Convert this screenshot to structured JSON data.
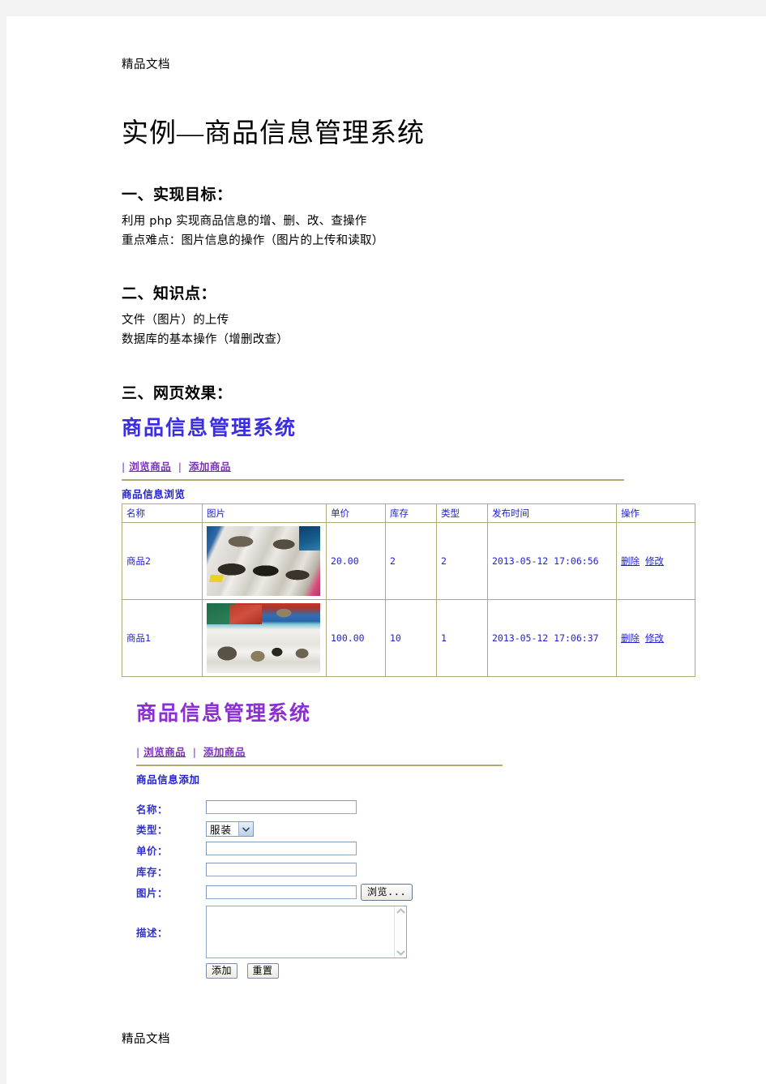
{
  "document": {
    "watermark_top": "精品文档",
    "watermark_bottom": "精品文档",
    "title": "实例—商品信息管理系统",
    "sections": [
      {
        "heading": "一、实现目标：",
        "lines": [
          "利用 php 实现商品信息的增、删、改、查操作",
          "重点难点：图片信息的操作（图片的上传和读取）"
        ]
      },
      {
        "heading": "二、知识点：",
        "lines": [
          "文件（图片）的上传",
          "数据库的基本操作（增删改查）"
        ]
      },
      {
        "heading": "三、网页效果：",
        "lines": []
      }
    ]
  },
  "mock_browse": {
    "app_title": "商品信息管理系统",
    "nav": {
      "leading_sep": "|",
      "items": [
        "浏览商品",
        "添加商品"
      ],
      "separator": "|"
    },
    "section_label": "商品信息浏览",
    "table": {
      "headers": [
        "名称",
        "图片",
        "单价",
        "库存",
        "类型",
        "发布时间",
        "操作"
      ],
      "rows": [
        {
          "name": "商品2",
          "image_alt": "商品2图片",
          "price": "20.00",
          "stock": "2",
          "type": "2",
          "time": "2013-05-12 17:06:56",
          "actions": [
            "删除",
            "修改"
          ]
        },
        {
          "name": "商品1",
          "image_alt": "商品1图片",
          "price": "100.00",
          "stock": "10",
          "type": "1",
          "time": "2013-05-12 17:06:37",
          "actions": [
            "删除",
            "修改"
          ]
        }
      ]
    }
  },
  "mock_add": {
    "app_title": "商品信息管理系统",
    "nav": {
      "leading_sep": "|",
      "items": [
        "浏览商品",
        "添加商品"
      ],
      "separator": "|"
    },
    "section_label": "商品信息添加",
    "form": {
      "name_label": "名称：",
      "name_value": "",
      "type_label": "类型：",
      "type_value": "服装",
      "price_label": "单价：",
      "price_value": "",
      "stock_label": "库存：",
      "stock_value": "",
      "image_label": "图片：",
      "image_value": "",
      "browse_button": "浏览...",
      "desc_label": "描述：",
      "desc_value": "",
      "submit_button": "添加",
      "reset_button": "重置"
    }
  },
  "colors": {
    "heading_blue": "#3b2ee0",
    "heading_purple": "#8b2fd0",
    "nav_purple": "#7b2fbf",
    "table_text_blue": "#2222cc",
    "table_border": "#b3aa7a",
    "rule": "#b3aa7a"
  }
}
